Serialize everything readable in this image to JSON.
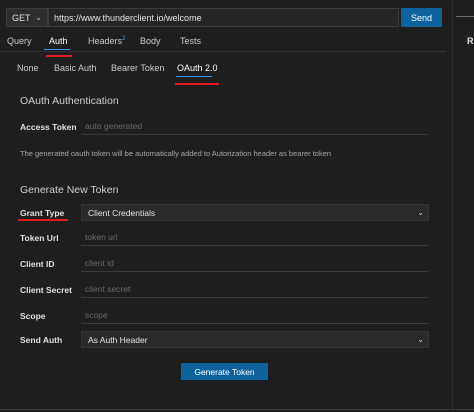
{
  "request": {
    "method": "GET",
    "url": "https://www.thunderclient.io/welcome",
    "send_label": "Send"
  },
  "tabs": [
    {
      "label": "Query"
    },
    {
      "label": "Auth",
      "active": true
    },
    {
      "label": "Headers",
      "badge": "2"
    },
    {
      "label": "Body"
    },
    {
      "label": "Tests"
    }
  ],
  "right_panel_letter": "R",
  "auth_tabs": [
    {
      "label": "None"
    },
    {
      "label": "Basic Auth"
    },
    {
      "label": "Bearer Token"
    },
    {
      "label": "OAuth 2.0",
      "active": true
    }
  ],
  "oauth": {
    "section_title": "OAuth Authentication",
    "access_token_label": "Access Token",
    "access_token_placeholder": "auto generated",
    "note": "The generated oauth token will be automatically added to Autorization header as bearer token"
  },
  "generate": {
    "section_title": "Generate New Token",
    "grant_type_label": "Grant Type",
    "grant_type_value": "Client Credentials",
    "token_url_label": "Token Url",
    "token_url_placeholder": "token url",
    "client_id_label": "Client ID",
    "client_id_placeholder": "client id",
    "client_secret_label": "Client Secret",
    "client_secret_placeholder": "client secret",
    "scope_label": "Scope",
    "scope_placeholder": "scope",
    "send_auth_label": "Send Auth",
    "send_auth_value": "As Auth Header",
    "button_label": "Generate Token"
  },
  "colors": {
    "accent": "#0e639c",
    "tab_indicator": "#3794ff",
    "highlight": "#e01b24",
    "background": "#1e1e1e"
  }
}
